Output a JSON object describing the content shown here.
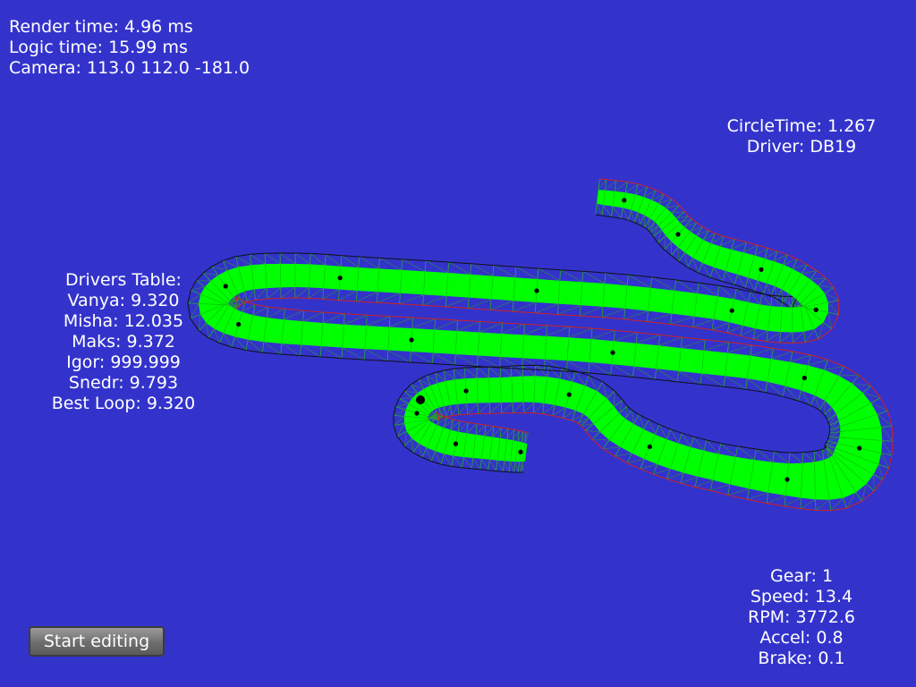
{
  "stats": {
    "render_time": "Render time: 4.96 ms",
    "logic_time": "Logic time: 15.99 ms",
    "camera": "Camera: 113.0 112.0 -181.0"
  },
  "lap": {
    "circle_time": "CircleTime: 1.267",
    "driver": "Driver: DB19"
  },
  "drivers_table": {
    "title": "Drivers Table:",
    "rows": [
      "Vanya: 9.320",
      "Misha: 12.035",
      "Maks: 9.372",
      "Igor: 999.999",
      "Snedr: 9.793"
    ],
    "best_loop": "Best Loop: 9.320"
  },
  "car": {
    "gear": "Gear: 1",
    "speed": "Speed: 13.4",
    "rpm": "RPM: 3772.6",
    "accel": "Accel: 0.8",
    "brake": "Brake: 0.1"
  },
  "controls": {
    "start_editing_label": "Start editing"
  },
  "colors": {
    "background": "#3333cc",
    "track_surface": "#00ff00",
    "outer_edge": "#cc2222",
    "inner_edge": "#111111",
    "checkpoint": "#000000"
  }
}
